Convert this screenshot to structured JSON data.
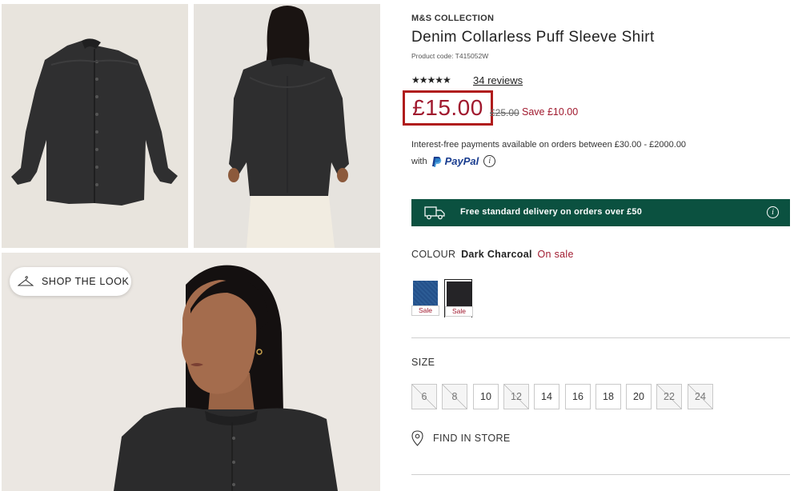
{
  "gallery": {
    "images": [
      {
        "alt": "shirt-flat-lay"
      },
      {
        "alt": "model-back-view"
      },
      {
        "alt": "model-front-closeup"
      }
    ],
    "shop_the_look": "SHOP THE LOOK",
    "shop_the_look_icon": "hanger-icon"
  },
  "product": {
    "brand": "M&S COLLECTION",
    "title": "Denim Collarless Puff Sleeve Shirt",
    "product_code": "Product code: T415052W",
    "rating": {
      "stars": "★★★★★",
      "value": 4.5,
      "reviews_label": "34 reviews"
    },
    "price": {
      "current": "£15.00",
      "was": "£25.00",
      "save": "Save £10.00"
    },
    "paypal": {
      "text": "Interest-free payments available on orders between £30.00 - £2000.00",
      "with": "with",
      "logo": "PayPal",
      "info_icon": "i"
    },
    "delivery": {
      "text": "Free standard delivery on orders over £50",
      "icon": "van-icon",
      "info_icon": "i"
    },
    "colour": {
      "label": "COLOUR",
      "selected": "Dark Charcoal",
      "sale_text": "On sale",
      "swatches": [
        {
          "name": "Indigo",
          "tag": "Sale",
          "color": "#2c5c95"
        },
        {
          "name": "Dark Charcoal",
          "tag": "Sale",
          "color": "#252427",
          "selected": true
        }
      ]
    },
    "size": {
      "label": "SIZE",
      "options": [
        {
          "label": "6",
          "available": false
        },
        {
          "label": "8",
          "available": false
        },
        {
          "label": "10",
          "available": true
        },
        {
          "label": "12",
          "available": false
        },
        {
          "label": "14",
          "available": true
        },
        {
          "label": "16",
          "available": true
        },
        {
          "label": "18",
          "available": true
        },
        {
          "label": "20",
          "available": true
        },
        {
          "label": "22",
          "available": false
        },
        {
          "label": "24",
          "available": false
        }
      ]
    },
    "find_in_store": "FIND IN STORE"
  },
  "colors": {
    "sale_red": "#a0192e",
    "delivery_green": "#0b5140",
    "price_highlight_border": "#b01c1c",
    "paypal_blue": "#1a3d8f"
  }
}
